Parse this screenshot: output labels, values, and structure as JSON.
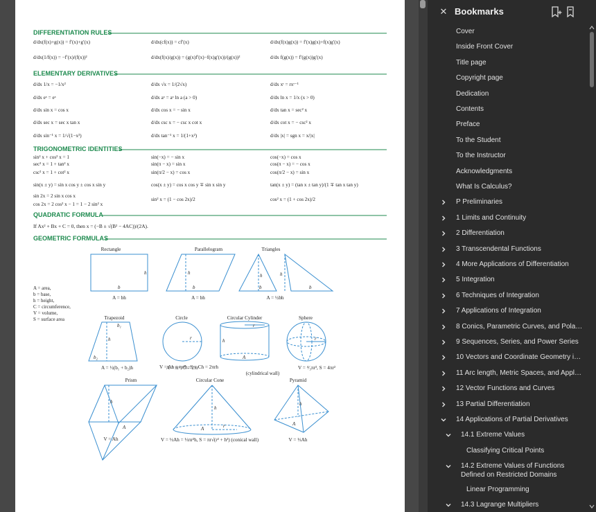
{
  "sections": {
    "diff": "DIFFERENTIATION RULES",
    "elem": "ELEMENTARY DERIVATIVES",
    "trig": "TRIGONOMETRIC IDENTITIES",
    "quad": "QUADRATIC FORMULA",
    "geom": "GEOMETRIC FORMULAS"
  },
  "formulas": {
    "diff": [
      "d/dx(f(x)+g(x)) = f′(x)+g′(x)",
      "d/dx(cf(x)) = cf′(x)",
      "d/dx(f(x)g(x)) = f′(x)g(x)+f(x)g′(x)",
      "d/dx(1/f(x)) = −f′(x)/(f(x))²",
      "d/dx(f(x)/g(x)) = (g(x)f′(x)−f(x)g′(x))/(g(x))²",
      "d/dx f(g(x)) = f′(g(x))g′(x)"
    ],
    "elem": [
      "d/dx 1/x = −1/x²",
      "d/dx √x = 1/(2√x)",
      "d/dx xʳ = rxʳ⁻¹",
      "d/dx eˣ = eˣ",
      "d/dx aˣ = aˣ ln a   (a > 0)",
      "d/dx ln x = 1/x   (x > 0)",
      "d/dx sin x = cos x",
      "d/dx cos x = − sin x",
      "d/dx tan x = sec² x",
      "d/dx sec x = sec x tan x",
      "d/dx csc x = − csc x cot x",
      "d/dx cot x = − csc² x",
      "d/dx sin⁻¹ x = 1/√(1−x²)",
      "d/dx tan⁻¹ x = 1/(1+x²)",
      "d/dx |x| = sgn x = x/|x|"
    ],
    "trig": [
      "sin² x + cos² x = 1",
      "sin(−x) = − sin x",
      "cos(−x) = cos x",
      "sec² x = 1 + tan² x",
      "sin(π − x) = sin x",
      "cos(π − x) = − cos x",
      "csc² x = 1 + cot² x",
      "sin(π/2 − x) = cos x",
      "cos(π/2 − x) = sin x",
      "sin(x ± y) = sin x cos y ± cos x sin y",
      "cos(x ± y) = cos x cos y ∓ sin x sin y",
      "tan(x ± y) = (tan x ± tan y)/(1 ∓ tan x tan y)",
      "sin 2x = 2 sin x cos x",
      "cos 2x = 2 cos² x − 1 = 1 − 2 sin² x",
      "sin² x = (1 − cos 2x)/2",
      "cos² x = (1 + cos 2x)/2"
    ],
    "quad": "If  Ax² + Bx + C = 0,  then  x = (−B ± √(B² − 4AC))/(2A)."
  },
  "geom": {
    "legend": [
      "A = area,",
      "b = base,",
      "h = height,",
      "C = circumference,",
      "V = volume,",
      "S = surface area"
    ],
    "captions": [
      "Rectangle",
      "Parallelogram",
      "Triangles",
      "Trapezoid",
      "Circle",
      "Circular Cylinder",
      "Sphere",
      "Prism",
      "Circular Cone",
      "Pyramid"
    ],
    "formulas": [
      "A = bh",
      "A = bh",
      "A = ½bh",
      "A = ½(b₁ + b₂)h",
      "A = πr², C = 2πr",
      "V = Ah = πr²h, S = Ch = 2πrh",
      "(cylindrical wall)",
      "V = ⁴⁄₃πr³, S = 4πr²",
      "V = Ah",
      "V = ⅓Ah = ⅓πr²h, S = πr√(r² + h²) (conical wall)",
      "V = ⅓Ah"
    ],
    "labels": [
      "h",
      "b",
      "h",
      "b",
      "h",
      "b",
      "h",
      "b",
      "b₁",
      "h",
      "b₂",
      "r",
      "r",
      "h",
      "A",
      "r",
      "h",
      "A",
      "h",
      "r",
      "A",
      "h",
      "A"
    ]
  },
  "panel": {
    "title": "Bookmarks",
    "icons": [
      "close-icon",
      "add-bookmark-icon",
      "bookmark-icon"
    ],
    "items": [
      {
        "label": "Cover",
        "level": 0,
        "chevron": "none"
      },
      {
        "label": "Inside Front Cover",
        "level": 0,
        "chevron": "none"
      },
      {
        "label": "Title page",
        "level": 0,
        "chevron": "none"
      },
      {
        "label": "Copyright page",
        "level": 0,
        "chevron": "none"
      },
      {
        "label": "Dedication",
        "level": 0,
        "chevron": "none"
      },
      {
        "label": "Contents",
        "level": 0,
        "chevron": "none"
      },
      {
        "label": "Preface",
        "level": 0,
        "chevron": "none"
      },
      {
        "label": "To the Student",
        "level": 0,
        "chevron": "none"
      },
      {
        "label": "To the Instructor",
        "level": 0,
        "chevron": "none"
      },
      {
        "label": "Acknowledgments",
        "level": 0,
        "chevron": "none"
      },
      {
        "label": "What Is Calculus?",
        "level": 0,
        "chevron": "none"
      },
      {
        "label": "P Preliminaries",
        "level": 0,
        "chevron": "right"
      },
      {
        "label": "1 Limits and Continuity",
        "level": 0,
        "chevron": "right"
      },
      {
        "label": "2 Differentiation",
        "level": 0,
        "chevron": "right"
      },
      {
        "label": "3 Transcendental Functions",
        "level": 0,
        "chevron": "right"
      },
      {
        "label": "4 More Applications of Differentiation",
        "level": 0,
        "chevron": "right"
      },
      {
        "label": "5 Integration",
        "level": 0,
        "chevron": "right"
      },
      {
        "label": "6 Techniques of Integration",
        "level": 0,
        "chevron": "right"
      },
      {
        "label": "7 Applications of Integration",
        "level": 0,
        "chevron": "right"
      },
      {
        "label": "8 Conics, Parametric Curves, and Polar Curves",
        "level": 0,
        "chevron": "right"
      },
      {
        "label": "9 Sequences, Series, and Power Series",
        "level": 0,
        "chevron": "right"
      },
      {
        "label": "10 Vectors and Coordinate Geometry in 3-Space",
        "level": 0,
        "chevron": "right"
      },
      {
        "label": "11 Arc length, Metric Spaces, and Applications",
        "level": 0,
        "chevron": "right"
      },
      {
        "label": "12 Vector Functions and Curves",
        "level": 0,
        "chevron": "right"
      },
      {
        "label": "13 Partial Differentiation",
        "level": 0,
        "chevron": "right"
      },
      {
        "label": "14 Applications of Partial Derivatives",
        "level": 0,
        "chevron": "down"
      },
      {
        "label": "14.1 Extreme Values",
        "level": 1,
        "chevron": "down"
      },
      {
        "label": "Classifying Critical Points",
        "level": 2,
        "chevron": "none"
      },
      {
        "label": "14.2 Extreme Values of Functions Defined on Restricted Domains",
        "level": 1,
        "chevron": "down"
      },
      {
        "label": "Linear Programming",
        "level": 2,
        "chevron": "none"
      },
      {
        "label": "14.3 Lagrange Multipliers",
        "level": 1,
        "chevron": "down"
      }
    ]
  },
  "colors": {
    "accent": "#1d8a4e",
    "figure": "#3a8fd0",
    "panel_bg": "#2b2b2b",
    "doc_bg": "#474747"
  }
}
